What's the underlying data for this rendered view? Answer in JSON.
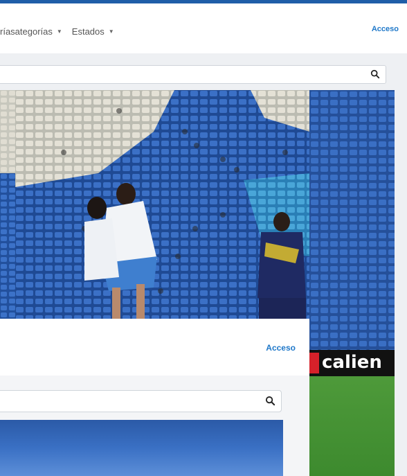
{
  "navbar": {
    "menu": [
      {
        "label": "rías"
      },
      {
        "label": "ategorías"
      },
      {
        "label": "Estados"
      }
    ],
    "login_label": "Acceso"
  },
  "search": {
    "placeholder": ""
  },
  "inner_page": {
    "login_label": "Acceso",
    "search_placeholder": ""
  },
  "sponsor": {
    "text": "calien"
  },
  "colors": {
    "accent": "#1f78c9",
    "topbar": "#1f5ea8",
    "stadium_blue": "#2a5fb0"
  },
  "icons": {
    "search": "search-icon",
    "caret": "caret-down-icon"
  }
}
